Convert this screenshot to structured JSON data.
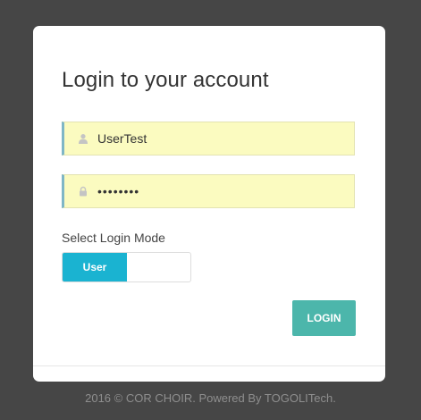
{
  "login": {
    "title": "Login to your account",
    "username_value": "UserTest",
    "username_icon": "user-icon",
    "password_value": "12345678",
    "password_icon": "lock-icon",
    "mode_label": "Select Login Mode",
    "mode_toggle_on_label": "User",
    "login_button_label": "LOGIN"
  },
  "footer": {
    "text": "2016 © COR CHOIR. Powered By TOGOLITech."
  },
  "colors": {
    "background": "#464646",
    "input_fill": "#fbfbc0",
    "toggle_accent": "#1ab3d1",
    "login_button": "#4cb6ab"
  }
}
